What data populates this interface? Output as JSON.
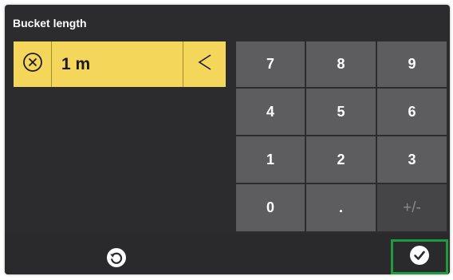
{
  "header": {
    "title": "Bucket length"
  },
  "input": {
    "value": "1 m",
    "clear_icon": "circle-x-icon",
    "backspace_icon": "chevron-left-icon"
  },
  "keypad": {
    "keys": [
      "7",
      "8",
      "9",
      "4",
      "5",
      "6",
      "1",
      "2",
      "3",
      "0",
      ".",
      "+/-"
    ]
  },
  "footer": {
    "reset_icon": "reset-circle-icon",
    "confirm_icon": "check-circle-icon"
  },
  "colors": {
    "background": "#2c2c2e",
    "input_yellow": "#f4d65a",
    "key_gray": "#5d5d60",
    "confirm_border": "#1f9a3e"
  }
}
